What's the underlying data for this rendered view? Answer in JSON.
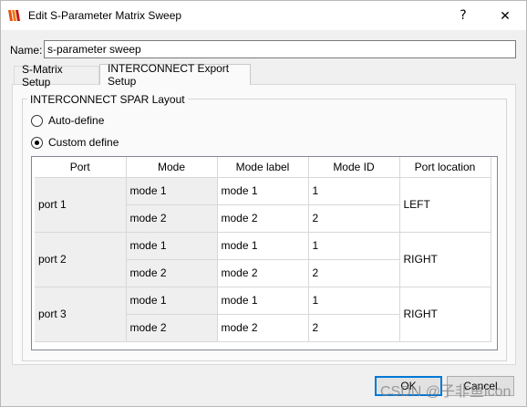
{
  "window": {
    "title": "Edit S-Parameter Matrix Sweep",
    "help_glyph": "?",
    "close_glyph": "✕",
    "accent_color": "#0078d7"
  },
  "name": {
    "label": "Name:",
    "value": "s-parameter sweep"
  },
  "tabs": [
    {
      "label": "S-Matrix Setup",
      "active": false
    },
    {
      "label": "INTERCONNECT Export Setup",
      "active": true
    }
  ],
  "layout_group": {
    "title": "INTERCONNECT SPAR Layout",
    "options": [
      {
        "label": "Auto-define",
        "checked": false
      },
      {
        "label": "Custom define",
        "checked": true
      }
    ]
  },
  "table": {
    "headers": [
      "Port",
      "Mode",
      "Mode label",
      "Mode ID",
      "Port location"
    ],
    "ports": [
      {
        "port": "port 1",
        "location": "LEFT",
        "modes": [
          {
            "mode": "mode 1",
            "label": "mode 1",
            "id": "1"
          },
          {
            "mode": "mode 2",
            "label": "mode 2",
            "id": "2"
          }
        ]
      },
      {
        "port": "port 2",
        "location": "RIGHT",
        "modes": [
          {
            "mode": "mode 1",
            "label": "mode 1",
            "id": "1"
          },
          {
            "mode": "mode 2",
            "label": "mode 2",
            "id": "2"
          }
        ]
      },
      {
        "port": "port 3",
        "location": "RIGHT",
        "modes": [
          {
            "mode": "mode 1",
            "label": "mode 1",
            "id": "1"
          },
          {
            "mode": "mode 2",
            "label": "mode 2",
            "id": "2"
          }
        ]
      }
    ]
  },
  "buttons": {
    "ok": "OK",
    "cancel": "Cancel"
  },
  "watermark": "CSDN @子非鱼icon",
  "icons": {
    "app": "lumerical-logo-icon",
    "help": "help-icon",
    "close": "close-icon"
  }
}
